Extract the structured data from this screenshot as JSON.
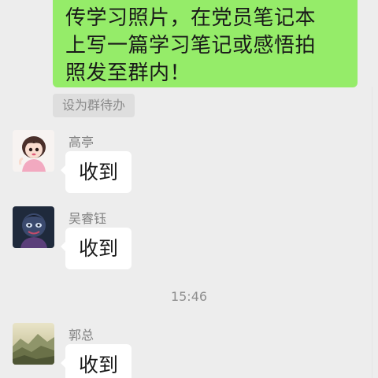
{
  "outgoing_message": {
    "lines": [
      "传学习照片，在党员笔记本",
      "上写一篇学习笔记或感悟拍",
      "照发至群内！"
    ],
    "bubble_color": "#95ec69"
  },
  "todo_chip": {
    "label": "设为群待办"
  },
  "messages": [
    {
      "sender": "高亭",
      "text": "收到",
      "avatar": "cartoon-girl-avatar"
    },
    {
      "sender": "吴睿钰",
      "text": "收到",
      "avatar": "cartoon-character-avatar"
    },
    {
      "sender": "郭总",
      "text": "收到",
      "avatar": "landscape-avatar"
    }
  ],
  "timestamp": "15:46",
  "colors": {
    "background": "#ededed",
    "incoming_bubble": "#ffffff",
    "sender_name": "#7f7f7f"
  }
}
